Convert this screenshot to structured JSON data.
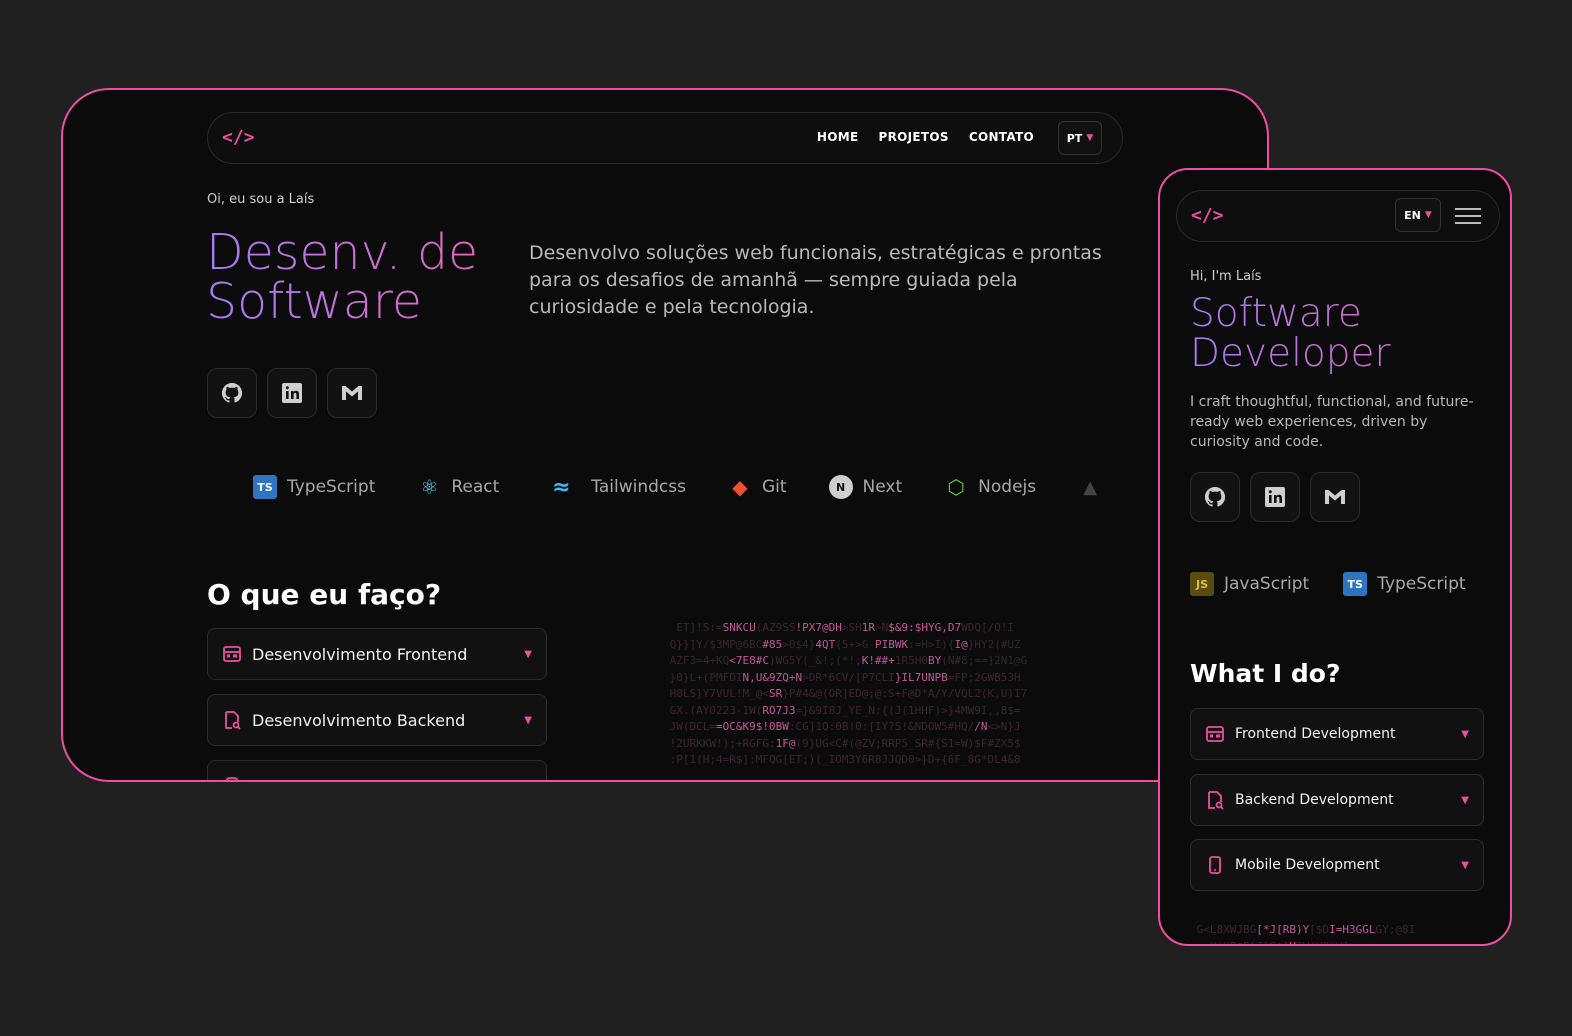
{
  "colors": {
    "accent": "#ec4fa1",
    "background": "#202020",
    "panel": "#0b0b0b",
    "gradient_start": "#a77af4",
    "gradient_end": "#e764b6"
  },
  "desktop": {
    "logo": "</>",
    "nav": {
      "home": "HOME",
      "projects": "PROJETOS",
      "contact": "CONTATO"
    },
    "language": "PT",
    "greeting": "Oi, eu sou a Laís",
    "title": "Desenv. de Software",
    "description": "Desenvolvo soluções web funcionais, estratégicas e prontas para os desafios de amanhã — sempre guiada pela curiosidade e pela tecnologia.",
    "social": [
      "github-icon",
      "linkedin-icon",
      "gmail-icon"
    ],
    "tech": [
      "TypeScript",
      "React",
      "Tailwindcss",
      "Git",
      "Next",
      "Nodejs"
    ],
    "section_title": "O que eu faço?",
    "services": [
      "Desenvolvimento Frontend",
      "Desenvolvimento Backend"
    ]
  },
  "mobile": {
    "logo": "</>",
    "language": "EN",
    "greeting": "Hi, I'm Laís",
    "title": "Software Developer",
    "description": "I craft thoughtful, functional, and future-ready web experiences, driven by curiosity and code.",
    "social": [
      "github-icon",
      "linkedin-icon",
      "gmail-icon"
    ],
    "tech": [
      "JavaScript",
      "TypeScript"
    ],
    "section_title": "What I do?",
    "services": [
      "Frontend Development",
      "Backend Development",
      "Mobile Development"
    ]
  }
}
